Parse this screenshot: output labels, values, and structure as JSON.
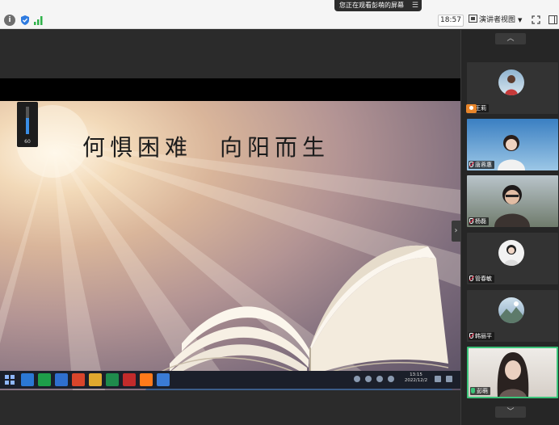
{
  "topbar": {
    "sharing_notice": "您正在观看彭萌的屏幕",
    "timer": "18:57",
    "view_mode": "演讲者视图"
  },
  "slide": {
    "title": "何惧困难　向阳而生",
    "volume_label": "60",
    "volume_level": 0.6
  },
  "taskbar": {
    "time": "13:15",
    "date": "2022/12/2",
    "app_colors": [
      "#2b78d4",
      "#1e9e4a",
      "#2f6fcf",
      "#d9452b",
      "#e0a82e",
      "#1f8b4c",
      "#c22b2b",
      "#ff7a1a",
      "#3a7bd5"
    ]
  },
  "panel": {
    "participants": [
      {
        "name": "王莉",
        "mic": "muted",
        "host": true
      },
      {
        "name": "唐蓉惠",
        "mic": "muted"
      },
      {
        "name": "杨磊",
        "mic": "muted"
      },
      {
        "name": "管春敏",
        "mic": "muted"
      },
      {
        "name": "韩丽平",
        "mic": "muted"
      },
      {
        "name": "彭萌",
        "mic": "live"
      }
    ]
  },
  "colors": {
    "accent_green": "#3cc47a",
    "host_orange": "#e8852a"
  }
}
